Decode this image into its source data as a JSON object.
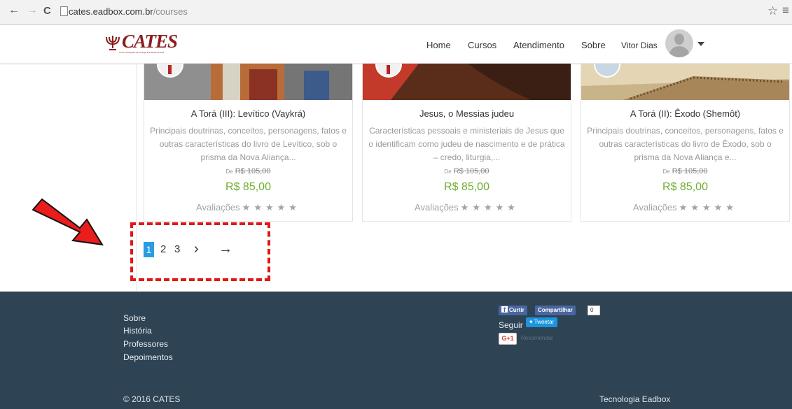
{
  "browser": {
    "url_domain": "cates.eadbox.com.br",
    "url_path": "/courses",
    "back_icon": "←",
    "forward_icon": "→",
    "reload_icon": "C",
    "star_icon": "☆",
    "menu_icon": "≡"
  },
  "header": {
    "logo_text": "CATES",
    "logo_subtext": "Centro Avançado de Teologia Enraizada da Torá",
    "nav": [
      "Home",
      "Cursos",
      "Atendimento",
      "Sobre"
    ],
    "user_name": "Vitor Dias"
  },
  "courses": [
    {
      "title": "A Torá (III): Levítico (Vaykrá)",
      "description": "Principais doutrinas, conceitos, personagens, fatos e outras características do livro de Levítico, sob o prisma da Nova Aliança...",
      "old_price_label": "De",
      "old_price": "R$ 105,00",
      "price": "R$ 85,00",
      "rating_label": "Avaliações",
      "stars": "★★★★★"
    },
    {
      "title": "Jesus, o Messias judeu",
      "description": "Características pessoais e ministeriais de Jesus que o identificam como judeu de nascimento e de prática – credo, liturgia,...",
      "old_price_label": "De",
      "old_price": "R$ 105,00",
      "price": "R$ 85,00",
      "rating_label": "Avaliações",
      "stars": "★★★★★"
    },
    {
      "title": "A Torá (II): Êxodo (Shemôt)",
      "description": "Principais doutrinas, conceitos, personagens, fatos e outras características do livro de Êxodo, sob o prisma da Nova Aliança e...",
      "old_price_label": "De",
      "old_price": "R$ 105,00",
      "price": "R$ 85,00",
      "rating_label": "Avaliações",
      "stars": "★★★★★"
    }
  ],
  "pagination": {
    "pages": [
      "1",
      "2",
      "3"
    ],
    "current": "1",
    "next": "›",
    "last": "→"
  },
  "footer": {
    "links": [
      "Sobre",
      "História",
      "Professores",
      "Depoimentos"
    ],
    "like_label": "Curtir",
    "share_label": "Compartilhar",
    "share_count": "0",
    "follow_label": "Seguir",
    "tweet_label": "Tweetar",
    "gplus_label": "G+1",
    "recommend_label": "Recomendar",
    "copyright": "© 2016 CATES",
    "tech": "Tecnologia Eadbox"
  },
  "colors": {
    "accent": "#2b9be2",
    "price_green": "#6fae2f",
    "footer_bg": "#2e4353",
    "annotation_red": "#e01818"
  }
}
